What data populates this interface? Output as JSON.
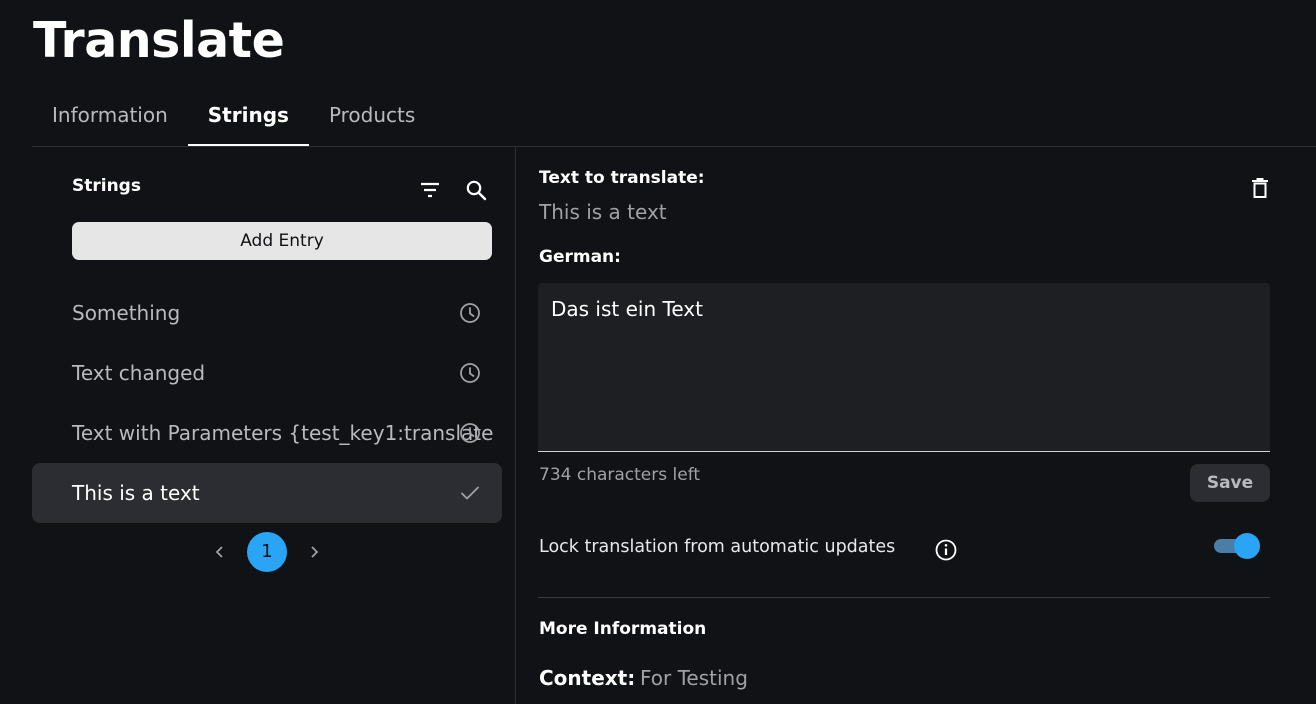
{
  "page": {
    "title": "Translate"
  },
  "tabs": [
    {
      "label": "Information",
      "active": false
    },
    {
      "label": "Strings",
      "active": true
    },
    {
      "label": "Products",
      "active": false
    }
  ],
  "strings_panel": {
    "heading": "Strings",
    "add_entry_label": "Add Entry",
    "items": [
      {
        "label": "Something",
        "status_icon": "clock-icon",
        "selected": false
      },
      {
        "label": "Text changed",
        "status_icon": "clock-icon",
        "selected": false
      },
      {
        "label": "Text with Parameters {test_key1:translate",
        "status_icon": "clock-icon",
        "selected": false
      },
      {
        "label": "This is a text",
        "status_icon": "check-icon",
        "selected": true
      }
    ],
    "pagination": {
      "current_page": "1"
    }
  },
  "editor": {
    "source_label": "Text to translate:",
    "source_text": "This is a text",
    "target_label": "German:",
    "translation_value": "Das ist ein Text",
    "chars_left": "734 characters left",
    "save_label": "Save",
    "lock_label": "Lock translation from automatic updates",
    "lock_enabled": true,
    "more_info_heading": "More Information",
    "context_label": "Context:",
    "context_value": "For Testing"
  },
  "colors": {
    "background": "#111215",
    "accent": "#2aa4f4",
    "selected_row": "#2c2d33"
  }
}
